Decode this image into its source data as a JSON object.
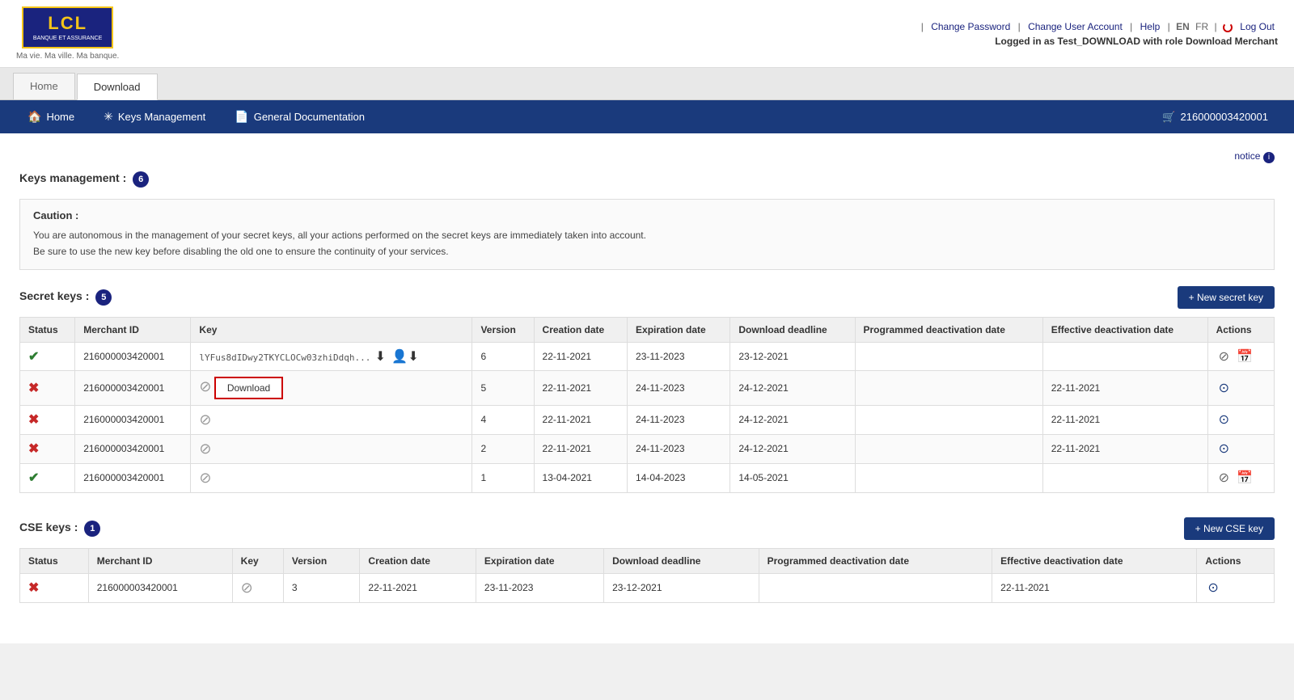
{
  "header": {
    "logo": {
      "text": "LCL",
      "subtitle": "BANQUE ET ASSURANCE",
      "tagline": "Ma vie. Ma ville. Ma banque."
    },
    "topnav": {
      "change_password": "Change Password",
      "change_user_account": "Change User Account",
      "help": "Help",
      "lang_en": "EN",
      "lang_fr": "FR",
      "logout": "Log Out",
      "logged_in": "Logged in as Test_DOWNLOAD with role Download Merchant"
    }
  },
  "tabs": [
    {
      "label": "Home",
      "active": false
    },
    {
      "label": "Download",
      "active": true
    }
  ],
  "navbar": {
    "items": [
      {
        "label": "Home",
        "icon": "🏠"
      },
      {
        "label": "Keys Management",
        "icon": "✳"
      },
      {
        "label": "General Documentation",
        "icon": "📄"
      }
    ],
    "merchant_id": "216000003420001",
    "cart_icon": "🛒"
  },
  "notice": {
    "label": "notice",
    "info_icon": "i"
  },
  "keys_management": {
    "title": "Keys management :",
    "count": 6
  },
  "caution": {
    "title": "Caution :",
    "lines": [
      "You are autonomous in the management of your secret keys, all your actions performed on the secret keys are immediately taken into account.",
      "Be sure to use the new key before disabling the old one to ensure the continuity of your services."
    ]
  },
  "secret_keys": {
    "title": "Secret keys :",
    "count": 5,
    "new_button": "+ New secret key",
    "columns": [
      "Status",
      "Merchant ID",
      "Key",
      "Version",
      "Creation date",
      "Expiration date",
      "Download deadline",
      "Programmed deactivation date",
      "Effective deactivation date",
      "Actions"
    ],
    "rows": [
      {
        "status": "ok",
        "merchant_id": "216000003420001",
        "key": "lYFus8dIDwy2TKYCLOCw03zhiDdqh...",
        "has_download_icons": true,
        "download_button": false,
        "version": "6",
        "creation_date": "22-11-2021",
        "expiration_date": "23-11-2023",
        "download_deadline": "23-12-2021",
        "programmed_deact": "",
        "effective_deact": "",
        "actions": [
          "disable",
          "calendar"
        ]
      },
      {
        "status": "err",
        "merchant_id": "216000003420001",
        "key": "",
        "has_download_icons": false,
        "download_button": true,
        "version": "5",
        "creation_date": "22-11-2021",
        "expiration_date": "24-11-2023",
        "download_deadline": "24-12-2021",
        "programmed_deact": "",
        "effective_deact": "22-11-2021",
        "actions": [
          "check"
        ]
      },
      {
        "status": "err",
        "merchant_id": "216000003420001",
        "key": "",
        "has_download_icons": false,
        "download_button": false,
        "version": "4",
        "creation_date": "22-11-2021",
        "expiration_date": "24-11-2023",
        "download_deadline": "24-12-2021",
        "programmed_deact": "",
        "effective_deact": "22-11-2021",
        "actions": [
          "check"
        ]
      },
      {
        "status": "err",
        "merchant_id": "216000003420001",
        "key": "",
        "has_download_icons": false,
        "download_button": false,
        "version": "2",
        "creation_date": "22-11-2021",
        "expiration_date": "24-11-2023",
        "download_deadline": "24-12-2021",
        "programmed_deact": "",
        "effective_deact": "22-11-2021",
        "actions": [
          "check"
        ]
      },
      {
        "status": "ok",
        "merchant_id": "216000003420001",
        "key": "",
        "has_download_icons": false,
        "download_button": false,
        "version": "1",
        "creation_date": "13-04-2021",
        "expiration_date": "14-04-2023",
        "download_deadline": "14-05-2021",
        "programmed_deact": "",
        "effective_deact": "",
        "actions": [
          "disable",
          "calendar"
        ]
      }
    ]
  },
  "cse_keys": {
    "title": "CSE keys :",
    "count": 1,
    "new_button": "+ New CSE key",
    "columns": [
      "Status",
      "Merchant ID",
      "Key",
      "Version",
      "Creation date",
      "Expiration date",
      "Download deadline",
      "Programmed deactivation date",
      "Effective deactivation date",
      "Actions"
    ],
    "rows": [
      {
        "status": "err",
        "merchant_id": "216000003420001",
        "key": "",
        "version": "3",
        "creation_date": "22-11-2021",
        "expiration_date": "23-11-2023",
        "download_deadline": "23-12-2021",
        "programmed_deact": "",
        "effective_deact": "22-11-2021",
        "actions": [
          "check"
        ]
      }
    ]
  },
  "download_button_label": "Download"
}
